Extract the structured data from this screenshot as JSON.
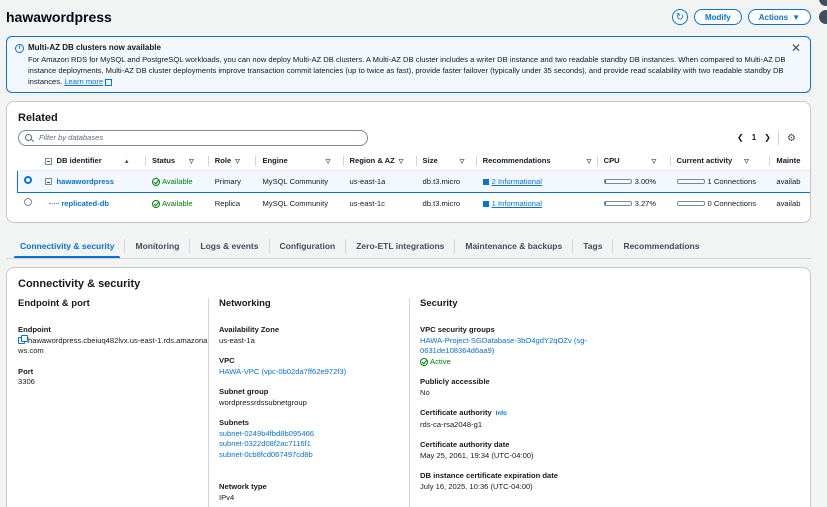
{
  "header": {
    "title": "hawawordpress",
    "modify_label": "Modify",
    "actions_label": "Actions"
  },
  "flash": {
    "title": "Multi-AZ DB clusters now available",
    "body": "For Amazon RDS for MySQL and PostgreSQL workloads, you can now deploy Multi-AZ DB clusters. A Multi-AZ DB cluster includes a writer DB instance and two readable standby DB instances. When compared to Multi-AZ DB instance deployments, Multi-AZ DB cluster deployments improve transaction commit latencies (up to twice as fast), provide faster failover (typically under 35 seconds), and provide read scalability with two readable standby DB instances.",
    "learn_more": "Learn more"
  },
  "related": {
    "title": "Related",
    "search_placeholder": "Filter by databases",
    "page": "1",
    "columns": [
      "DB identifier",
      "Status",
      "Role",
      "Engine",
      "Region & AZ",
      "Size",
      "Recommendations",
      "CPU",
      "Current activity",
      "Mainte"
    ],
    "rows": [
      {
        "id": "hawawordpress",
        "status": "Available",
        "role": "Primary",
        "engine": "MySQL Community",
        "region": "us-east-1a",
        "size": "db.t3.micro",
        "recs": "2 Informational",
        "cpu": "3.00%",
        "cpu_pct": 3.0,
        "activity": "1 Connections",
        "maint": "availab"
      },
      {
        "id": "replicated-db",
        "status": "Available",
        "role": "Replica",
        "engine": "MySQL Community",
        "region": "us-east-1c",
        "size": "db.t3.micro",
        "recs": "1 Informational",
        "cpu": "3.27%",
        "cpu_pct": 3.27,
        "activity": "0 Connections",
        "maint": "availab"
      }
    ]
  },
  "tabs": [
    "Connectivity & security",
    "Monitoring",
    "Logs & events",
    "Configuration",
    "Zero-ETL integrations",
    "Maintenance & backups",
    "Tags",
    "Recommendations"
  ],
  "conn": {
    "title": "Connectivity & security",
    "endpoint_port": {
      "heading": "Endpoint & port",
      "endpoint_label": "Endpoint",
      "endpoint_value": "hawawordpress.cbeiuq482lvx.us-east-1.rds.amazonaws.com",
      "port_label": "Port",
      "port_value": "3306"
    },
    "networking": {
      "heading": "Networking",
      "az_label": "Availability Zone",
      "az_value": "us-east-1a",
      "vpc_label": "VPC",
      "vpc_value": "HAWA-VPC (vpc-0b02da7ff62e972f3)",
      "subnet_group_label": "Subnet group",
      "subnet_group_value": "wordpressrdssubnetgroup",
      "subnets_label": "Subnets",
      "subnets": [
        "subnet-0249b4fbd8b095466",
        "subnet-0322d08f2ac7116f1",
        "subnet-0cb8fcd067497cd8b"
      ],
      "network_type_label": "Network type",
      "network_type_value": "IPv4"
    },
    "security": {
      "heading": "Security",
      "sg_label": "VPC security groups",
      "sg_value": "HAWA-Project-SGDatabase-3bO4gdY2qOZv (sg-0631de108364d6aa9)",
      "sg_status": "Active",
      "public_label": "Publicly accessible",
      "public_value": "No",
      "ca_label": "Certificate authority",
      "ca_info": "Info",
      "ca_value": "rds-ca-rsa2048-g1",
      "ca_date_label": "Certificate authority date",
      "ca_date_value": "May 25, 2061, 19:34 (UTC-04:00)",
      "exp_label": "DB instance certificate expiration date",
      "exp_value": "July 16, 2025, 10:36 (UTC-04:00)"
    }
  },
  "colors": {
    "accent": "#0972d3",
    "success": "#037f0c"
  }
}
